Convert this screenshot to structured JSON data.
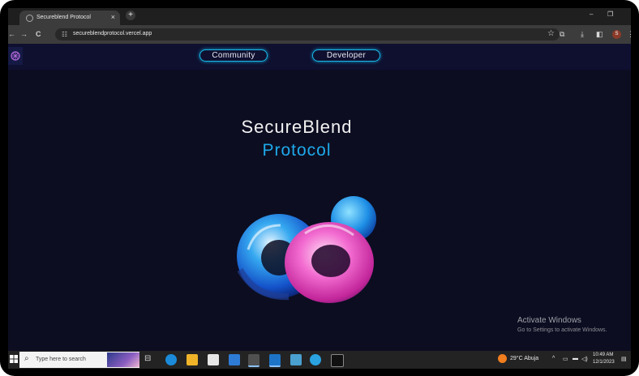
{
  "browser": {
    "tab_title": "Secureblend Protocol",
    "tab_close": "×",
    "new_tab": "+",
    "minimize": "–",
    "restore": "❐",
    "back": "←",
    "forward": "→",
    "reload": "C",
    "url": "secureblendprotocol.vercel.app",
    "profile_initial": "S"
  },
  "site": {
    "nav": {
      "community_label": "Community",
      "developer_label": "Developer"
    },
    "hero": {
      "line1": "SecureBlend",
      "line2": "Protocol"
    },
    "colors": {
      "accent": "#1ea9ea",
      "background": "#0c0d21",
      "pill_border": "#18b6e4"
    }
  },
  "watermark": {
    "title": "Activate Windows",
    "subtitle": "Go to Settings to activate Windows."
  },
  "taskbar": {
    "search_placeholder": "Type here to search",
    "weather": "29°C  Abuja",
    "time": "10:49 AM",
    "date": "12/1/2023",
    "icons": [
      "task-view-icon",
      "edge-icon",
      "file-explorer-icon",
      "store-icon",
      "mail-icon",
      "chrome-icon",
      "vscode-icon",
      "app-icon",
      "telegram-icon",
      "terminal-icon"
    ]
  }
}
